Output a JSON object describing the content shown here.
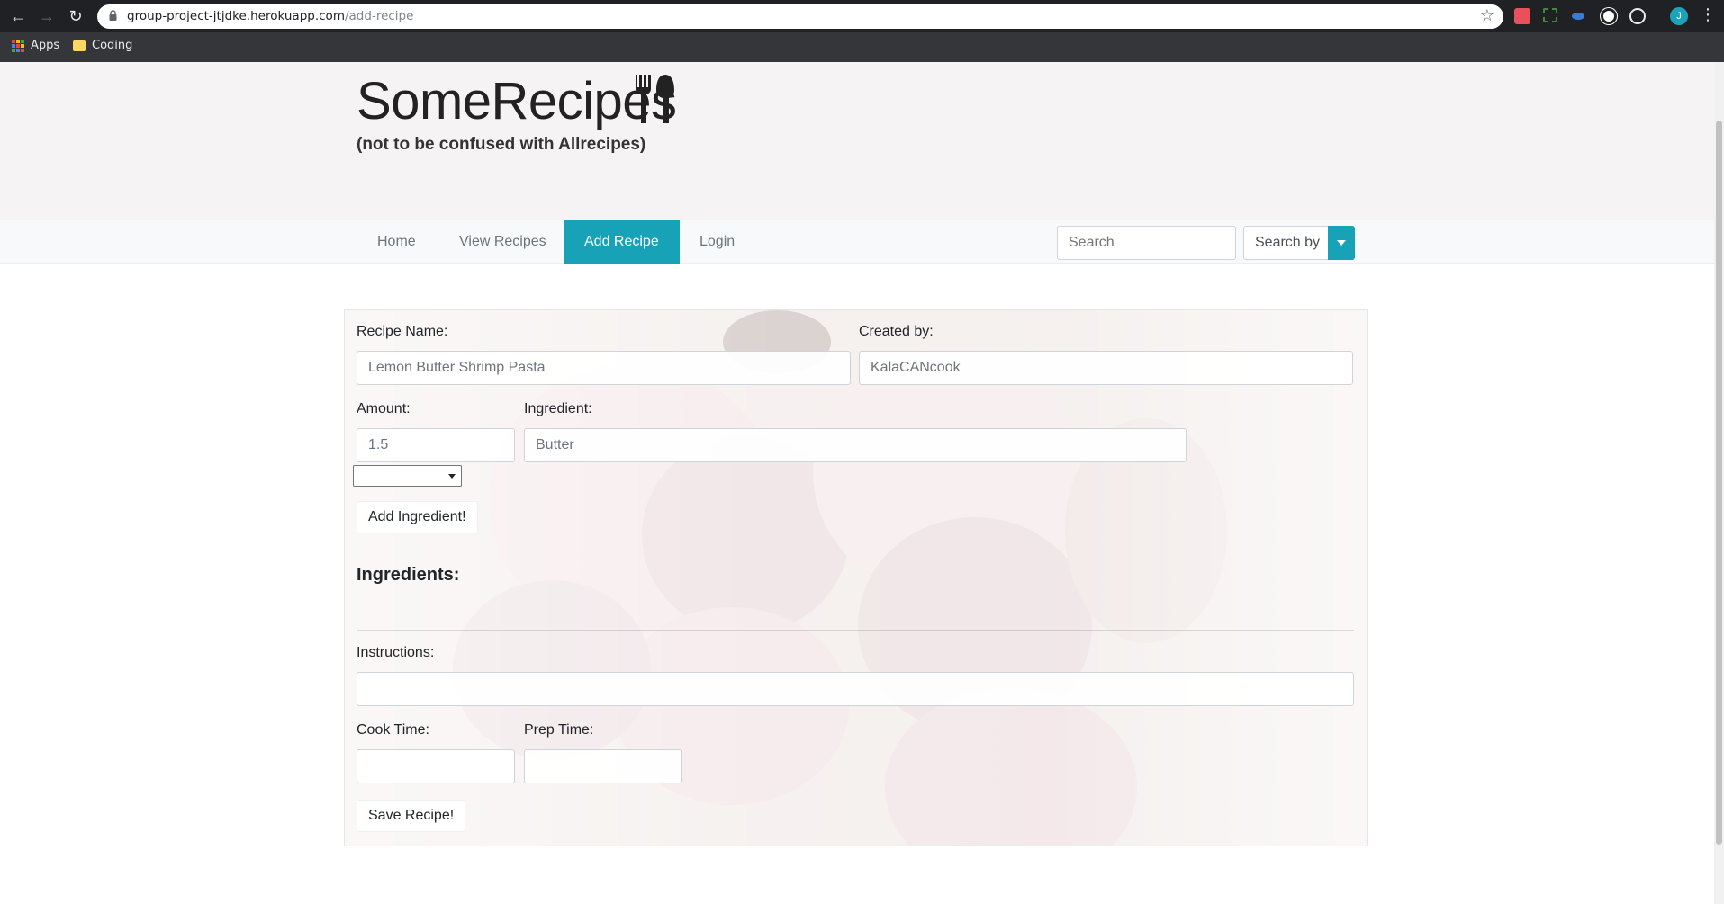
{
  "browser": {
    "url_host": "group-project-jtjdke.herokuapp.com",
    "url_path": "/add-recipe",
    "profile_initial": "J",
    "bookmarks": [
      {
        "label": "Apps",
        "icon": "apps-grid-icon"
      },
      {
        "label": "Coding",
        "icon": "folder-icon"
      }
    ]
  },
  "site": {
    "title": "SomeRecipes",
    "logo_icon": "fork-spoon-icon",
    "tagline": "(not to be confused with Allrecipes)"
  },
  "nav": {
    "items": [
      {
        "label": "Home",
        "active": false
      },
      {
        "label": "View Recipes",
        "active": false
      },
      {
        "label": "Add Recipe",
        "active": true
      },
      {
        "label": "Login",
        "active": false
      }
    ],
    "search_placeholder": "Search",
    "search_by_label": "Search by",
    "accent_color": "#17a2b8"
  },
  "form": {
    "recipe_name_label": "Recipe Name:",
    "recipe_name_value": "Lemon Butter Shrimp Pasta",
    "created_by_label": "Created by:",
    "created_by_value": "KalaCANcook",
    "amount_label": "Amount:",
    "amount_value": "1.5",
    "ingredient_label": "Ingredient:",
    "ingredient_value": "Butter",
    "unit_value": "",
    "add_ingredient_label": "Add Ingredient!",
    "ingredients_heading": "Ingredients:",
    "instructions_label": "Instructions:",
    "instructions_value": "",
    "cook_time_label": "Cook Time:",
    "cook_time_value": "",
    "prep_time_label": "Prep Time:",
    "prep_time_value": "",
    "save_label": "Save Recipe!"
  }
}
